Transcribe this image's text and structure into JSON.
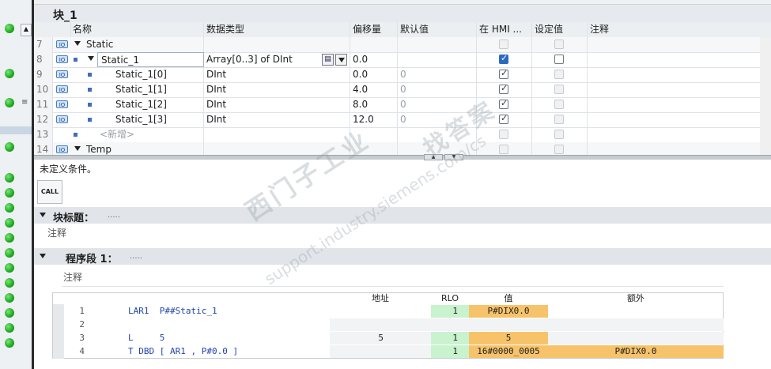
{
  "block": {
    "title": "块_1"
  },
  "table": {
    "headers": {
      "name": "名称",
      "datatype": "数据类型",
      "offset": "偏移量",
      "default": "默认值",
      "hmi": "在 HMI ...",
      "setpoint": "设定值",
      "comment": "注释"
    },
    "rows": [
      {
        "num": "7",
        "name": "Static",
        "datatype": "",
        "offset": "",
        "default": ""
      },
      {
        "num": "8",
        "name": "Static_1",
        "datatype": "Array[0..3] of DInt",
        "offset": "0.0",
        "default": ""
      },
      {
        "num": "9",
        "name": "Static_1[0]",
        "datatype": "DInt",
        "offset": "0.0",
        "default": "0"
      },
      {
        "num": "10",
        "name": "Static_1[1]",
        "datatype": "DInt",
        "offset": "4.0",
        "default": "0"
      },
      {
        "num": "11",
        "name": "Static_1[2]",
        "datatype": "DInt",
        "offset": "8.0",
        "default": "0"
      },
      {
        "num": "12",
        "name": "Static_1[3]",
        "datatype": "DInt",
        "offset": "12.0",
        "default": "0"
      },
      {
        "num": "13",
        "name": "<新增>",
        "datatype": "",
        "offset": "",
        "default": ""
      },
      {
        "num": "14",
        "name": "Temp",
        "datatype": "",
        "offset": "",
        "default": ""
      }
    ],
    "io_icon": "IO",
    "dropdown_icon": "list-icon"
  },
  "editor": {
    "condition": "未定义条件。",
    "call_label": "CALL",
    "block_heading_label": "块标题：",
    "block_heading_value": ".....",
    "block_comment": "注释",
    "network_label": "程序段 1：",
    "network_value": ".....",
    "network_comment": "注释"
  },
  "stl": {
    "headers": {
      "address": "地址",
      "rlo": "RLO",
      "value": "值",
      "extra": "额外"
    },
    "lines": [
      {
        "num": "1",
        "code": "LAR1  P##Static_1",
        "address": "",
        "rlo": "1",
        "value": "P#DIX0.0",
        "extra": ""
      },
      {
        "num": "2",
        "code": "",
        "address": "",
        "rlo": "",
        "value": "",
        "extra": ""
      },
      {
        "num": "3",
        "code": "L     5",
        "address": "5",
        "rlo": "1",
        "value": "5",
        "extra": ""
      },
      {
        "num": "4",
        "code": "T DBD [ AR1 , P#0.0 ]",
        "address": "",
        "rlo": "1",
        "value": "16#0000_0005",
        "extra": "P#DIX0.0"
      }
    ]
  },
  "watermark": {
    "cn": "西门子工业",
    "cn2": "找答案",
    "url": "support.industry.siemens.com/cs"
  },
  "colors": {
    "accent_green": "#22b022",
    "value_orange": "#f7c36a",
    "rlo_green": "#c9f2cf"
  }
}
